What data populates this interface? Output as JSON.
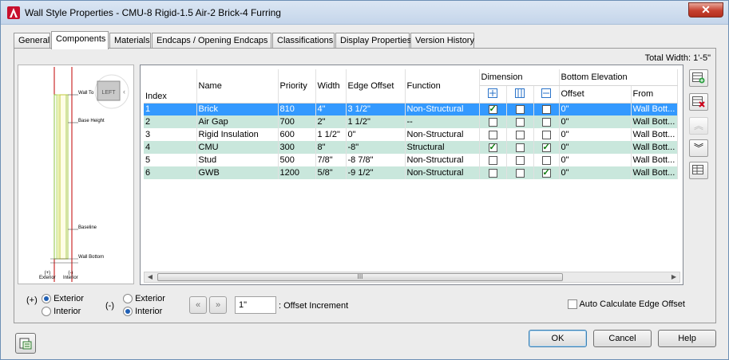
{
  "window": {
    "title": "Wall Style Properties - CMU-8 Rigid-1.5 Air-2 Brick-4 Furring",
    "close_label": "✕"
  },
  "tabs": [
    {
      "label": "General"
    },
    {
      "label": "Components"
    },
    {
      "label": "Materials"
    },
    {
      "label": "Endcaps / Opening Endcaps"
    },
    {
      "label": "Classifications"
    },
    {
      "label": "Display Properties"
    },
    {
      "label": "Version History"
    }
  ],
  "total_width": "Total Width: 1'-5\"",
  "preview": {
    "view_cube_label": "LEFT",
    "labels": {
      "wall_top": "Wall To",
      "base_height": "Base Height",
      "baseline": "Baseline",
      "wall_bottom": "Wall Bottom",
      "exterior": "(+)\nExterior",
      "interior": "(-)\nInterior"
    }
  },
  "grid": {
    "headers": {
      "index": "Index",
      "name": "Name",
      "priority": "Priority",
      "width": "Width",
      "edge_offset": "Edge Offset",
      "function": "Function",
      "dimension": "Dimension",
      "bottom_elevation": "Bottom Elevation",
      "offset": "Offset",
      "from": "From"
    },
    "rows": [
      {
        "index": "1",
        "name": "Brick",
        "priority": "810",
        "width": "4\"",
        "edge_offset": "3 1/2\"",
        "function": "Non-Structural",
        "dim": [
          true,
          false,
          false
        ],
        "offset": "0\"",
        "from": "Wall Bott..."
      },
      {
        "index": "2",
        "name": "Air Gap",
        "priority": "700",
        "width": "2\"",
        "edge_offset": "1 1/2\"",
        "function": "--",
        "dim": [
          false,
          false,
          false
        ],
        "offset": "0\"",
        "from": "Wall Bott..."
      },
      {
        "index": "3",
        "name": "Rigid Insulation",
        "priority": "600",
        "width": "1 1/2\"",
        "edge_offset": "0\"",
        "function": "Non-Structural",
        "dim": [
          false,
          false,
          false
        ],
        "offset": "0\"",
        "from": "Wall Bott..."
      },
      {
        "index": "4",
        "name": "CMU",
        "priority": "300",
        "width": "8\"",
        "edge_offset": "-8\"",
        "function": "Structural",
        "dim": [
          true,
          false,
          true
        ],
        "offset": "0\"",
        "from": "Wall Bott..."
      },
      {
        "index": "5",
        "name": "Stud",
        "priority": "500",
        "width": "7/8\"",
        "edge_offset": "-8 7/8\"",
        "function": "Non-Structural",
        "dim": [
          false,
          false,
          false
        ],
        "offset": "0\"",
        "from": "Wall Bott..."
      },
      {
        "index": "6",
        "name": "GWB",
        "priority": "1200",
        "width": "5/8\"",
        "edge_offset": "-9 1/2\"",
        "function": "Non-Structural",
        "dim": [
          false,
          false,
          true
        ],
        "offset": "0\"",
        "from": "Wall Bott..."
      }
    ],
    "scroll_grip": "III"
  },
  "options": {
    "plus_label": "(+)",
    "minus_label": "(-)",
    "exterior_label": "Exterior",
    "interior_label": "Interior",
    "plus_selected": "Exterior",
    "minus_selected": "Interior",
    "offset_increment_value": "1\"",
    "offset_increment_label": ": Offset Increment",
    "auto_calc_label": "Auto Calculate Edge Offset",
    "auto_calc_checked": false
  },
  "buttons": {
    "ok": "OK",
    "cancel": "Cancel",
    "help": "Help"
  }
}
